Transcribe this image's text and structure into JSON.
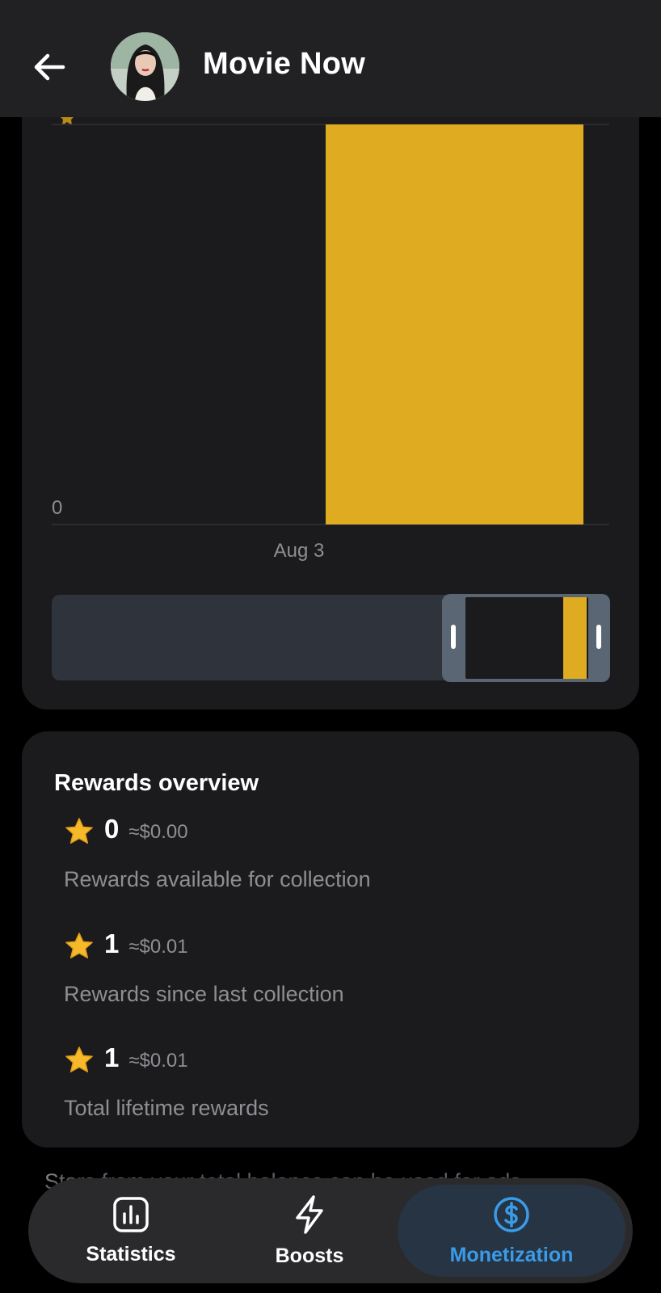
{
  "header": {
    "title": "Movie Now",
    "back_icon": "back-arrow-icon",
    "avatar": "channel-avatar"
  },
  "chart_data": {
    "type": "bar",
    "categories": [
      "Aug 3"
    ],
    "values": [
      1
    ],
    "y_tick_labels": [
      "0"
    ],
    "ylim": [
      0,
      1
    ],
    "bar_color": "#deab21",
    "grid": true
  },
  "rewards": {
    "title": "Rewards overview",
    "items": [
      {
        "value": "0",
        "usd": "≈$0.00",
        "desc": "Rewards available for collection"
      },
      {
        "value": "1",
        "usd": "≈$0.01",
        "desc": "Rewards since last collection"
      },
      {
        "value": "1",
        "usd": "≈$0.01",
        "desc": "Total lifetime rewards"
      }
    ]
  },
  "footer": {
    "text": "Stars from your total balance can be used for ads"
  },
  "nav": {
    "items": [
      {
        "label": "Statistics",
        "icon": "statistics-icon"
      },
      {
        "label": "Boosts",
        "icon": "lightning-icon"
      },
      {
        "label": "Monetization",
        "icon": "dollar-icon",
        "active": true
      }
    ]
  },
  "colors": {
    "accent": "#3a9be8",
    "bar": "#deab21",
    "card": "#1b1b1d",
    "header": "#212123"
  }
}
